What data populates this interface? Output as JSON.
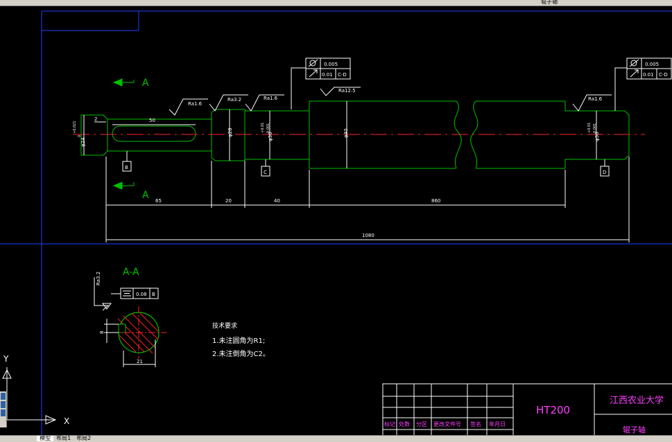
{
  "window": {
    "title": "辊子轴"
  },
  "toolbar": {
    "icon_count": 34
  },
  "tabs": {
    "items": [
      {
        "label": "模型",
        "active": true
      },
      {
        "label": "布局1",
        "active": false
      },
      {
        "label": "布局2",
        "active": false
      }
    ]
  },
  "drawing": {
    "section_marker": "A",
    "section_title": "A-A",
    "tech_requirements": {
      "title": "技术要求",
      "items": [
        "1.未注圆角为R1;",
        "2.未注倒角为C2。"
      ]
    },
    "dims": {
      "d1": "65",
      "d2": "20",
      "d3": "40",
      "d4": "860",
      "total": "1080",
      "key_len": "50",
      "key_off": "2",
      "key_width": "21",
      "key_depth": "8"
    },
    "diameters": {
      "d24": "φ24",
      "d24_tol_up": "+0.021",
      "d24_tol_lo": "0",
      "d28": "φ28",
      "d30a": "φ30",
      "d30a_tol_up": "+0.01",
      "d30a_tol_lo": "0.001",
      "d40": "φ40",
      "d30b": "φ30",
      "d30b_tol_up": "+0.01",
      "d30b_tol_lo": "0.001"
    },
    "roughness": {
      "r1": "Ra1.6",
      "r2": "Ra3.2",
      "r3": "Ra1.6",
      "r4": "Ra12.5",
      "r5": "Ra1.6",
      "r6": "Ra3.2"
    },
    "datums": {
      "b": "B",
      "c": "C",
      "d": "D"
    },
    "tolerance_frames": {
      "left": {
        "cyl": "0.005",
        "runout": "0.01",
        "ref": "C-D"
      },
      "right": {
        "cyl": "0.005",
        "runout": "0.01",
        "ref": "C-D"
      },
      "sym": {
        "value": "0.08",
        "ref": "B"
      }
    },
    "axis_labels": {
      "y": "Y",
      "x": "X"
    }
  },
  "title_block": {
    "material": "HT200",
    "school": "江西农业大学",
    "part_name": "辊子轴",
    "headers": [
      "标记",
      "处数",
      "分区",
      "更改文件号",
      "签名",
      "年月日"
    ]
  },
  "colors": {
    "background": "#000000",
    "white": "#ffffff",
    "green": "#00c000",
    "red": "#ff2020",
    "blue": "#2040ff",
    "magenta": "#ff40ff",
    "cyan": "#40ffff"
  }
}
